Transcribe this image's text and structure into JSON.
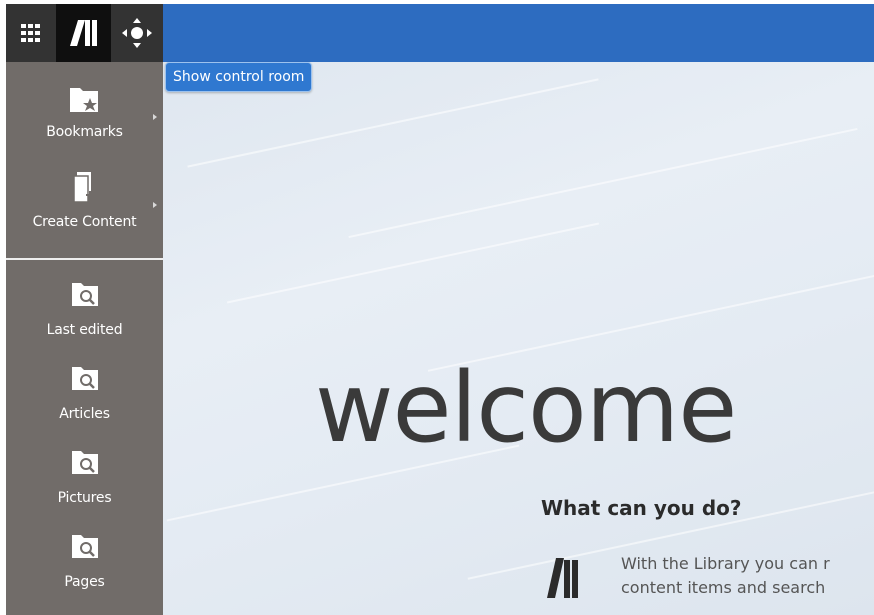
{
  "toolbar": {
    "apps_icon": "apps-grid-icon",
    "library_icon": "library-logo-icon",
    "control_room_icon": "move-arrows-icon"
  },
  "tooltip": {
    "text": "Show control room"
  },
  "sidebar": {
    "items": [
      {
        "label": "Bookmarks",
        "icon": "bookmark-folder-icon",
        "has_submenu": true
      },
      {
        "label": "Create Content",
        "icon": "create-content-icon",
        "has_submenu": true
      },
      {
        "label": "Last edited",
        "icon": "search-folder-icon"
      },
      {
        "label": "Articles",
        "icon": "search-folder-icon"
      },
      {
        "label": "Pictures",
        "icon": "search-folder-icon"
      },
      {
        "label": "Pages",
        "icon": "search-folder-icon"
      }
    ]
  },
  "main": {
    "welcome": "welcome",
    "what_title": "What can you do?",
    "desc_line1": "With the Library you can r",
    "desc_line2": "content items and search"
  },
  "colors": {
    "header": "#2d6cc0",
    "sidebar": "#716c69",
    "tooltip": "#2f78d0",
    "dark_button": "#333333"
  }
}
